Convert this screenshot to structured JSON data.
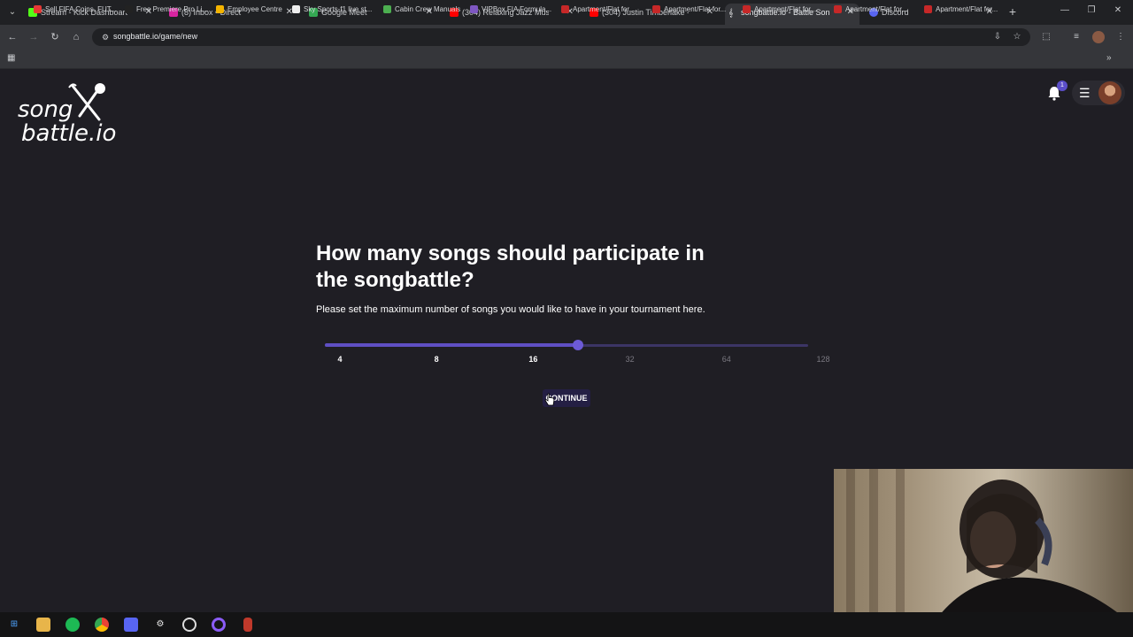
{
  "browser": {
    "tabs": [
      {
        "title": "Stream - Kick Dashboard",
        "favicon_color": "#53fc18",
        "active": false
      },
      {
        "title": "(8) Inbox • Direct",
        "favicon_color": "#d6249f",
        "active": false
      },
      {
        "title": "Google Meet",
        "favicon_color": "#34a853",
        "active": false
      },
      {
        "title": "(304) Relaxing Jazz Music - Bac",
        "favicon_color": "#ff0000",
        "active": false
      },
      {
        "title": "(304) Justin Timberlake - Rock Y",
        "favicon_color": "#ff0000",
        "active": false
      },
      {
        "title": "songbattle.io - Battle Songs ag",
        "favicon_color": "#ffffff",
        "active": true
      },
      {
        "title": "Discord",
        "favicon_color": "#5865f2",
        "active": false
      }
    ],
    "new_tab_symbol": "+",
    "url": "songbattle.io/game/new",
    "bookmarks": [
      {
        "label": "Sell FIFA Coins, FUT...",
        "favicon_color": "#e53935"
      },
      {
        "label": "Free Premiere Pro Li...",
        "favicon_color": "#222222"
      },
      {
        "label": "Employee Centre",
        "favicon_color": "#f4b400"
      },
      {
        "label": "Sky Sports-f1 live st...",
        "favicon_color": "#eeeeee"
      },
      {
        "label": "Cabin Crew Manuals",
        "favicon_color": "#4caf50"
      },
      {
        "label": "VIPBox FIA Formula...",
        "favicon_color": "#7e57c2"
      },
      {
        "label": "Apartment/Flat for...",
        "favicon_color": "#c62828"
      },
      {
        "label": "Apartment/Flat for...",
        "favicon_color": "#c62828"
      },
      {
        "label": "Apartment/Flat for...",
        "favicon_color": "#c62828"
      },
      {
        "label": "Apartment/Flat for...",
        "favicon_color": "#c62828"
      },
      {
        "label": "Apartment/Flat for...",
        "favicon_color": "#c62828"
      }
    ],
    "icons": {
      "back": "back-arrow-icon",
      "forward": "forward-arrow-icon",
      "reload": "reload-icon",
      "home": "home-icon",
      "install": "install-app-icon",
      "star": "bookmark-star-icon",
      "extensions": "extensions-icon",
      "media": "media-control-icon"
    }
  },
  "site": {
    "logo": {
      "line1": "song",
      "line2": "battle.io"
    },
    "notification_count": "1",
    "colors": {
      "accent": "#5f4fc4",
      "background": "#1f1e24",
      "button": "#241f44"
    }
  },
  "main": {
    "question": "How many songs should participate in the songbattle?",
    "subtitle": "Please set the maximum number of songs you would like to have in your tournament here.",
    "slider": {
      "marks": [
        "4",
        "8",
        "16",
        "32",
        "64",
        "128"
      ],
      "selected_value": "16",
      "min": 4,
      "max": 128
    },
    "continue_label": "CONTINUE"
  },
  "taskbar": {
    "apps": [
      "windows-start-icon",
      "file-explorer-icon",
      "spotify-icon",
      "chrome-icon",
      "discord-icon",
      "settings-icon",
      "obs-icon",
      "streaming-app-icon",
      "recorder-icon"
    ]
  }
}
